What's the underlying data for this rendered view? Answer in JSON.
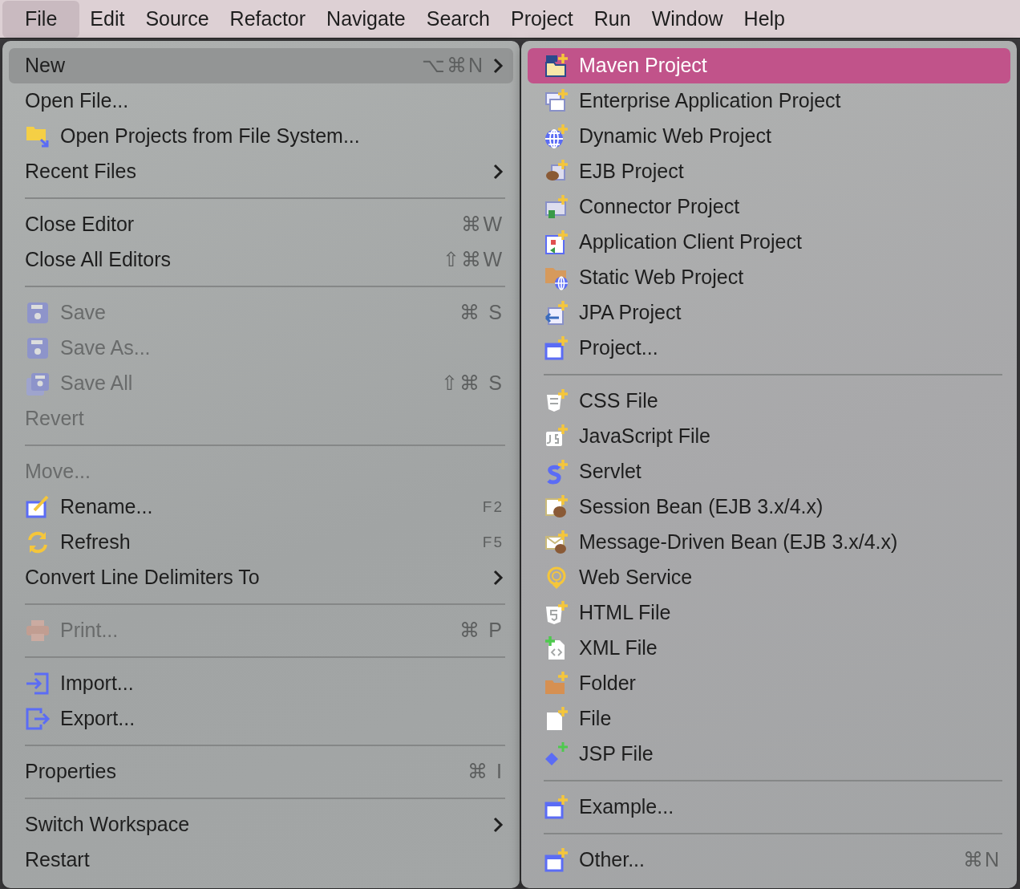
{
  "menu_bar": [
    {
      "label": "File",
      "selected": true
    },
    {
      "label": "Edit",
      "selected": false
    },
    {
      "label": "Source",
      "selected": false
    },
    {
      "label": "Refactor",
      "selected": false
    },
    {
      "label": "Navigate",
      "selected": false
    },
    {
      "label": "Search",
      "selected": false
    },
    {
      "label": "Project",
      "selected": false
    },
    {
      "label": "Run",
      "selected": false
    },
    {
      "label": "Window",
      "selected": false
    },
    {
      "label": "Help",
      "selected": false
    }
  ],
  "file_menu": [
    {
      "kind": "item",
      "label": "New",
      "shortcut": "⌥⌘N",
      "submenu": true,
      "selected": true,
      "disabled": false
    },
    {
      "kind": "item",
      "label": "Open File...",
      "submenu": false,
      "selected": false,
      "disabled": false
    },
    {
      "kind": "item",
      "label": "Open Projects from File System...",
      "submenu": false,
      "selected": false,
      "disabled": false
    },
    {
      "kind": "item",
      "label": "Recent Files",
      "submenu": true,
      "selected": false,
      "disabled": false
    },
    {
      "kind": "separator"
    },
    {
      "kind": "item",
      "label": "Close Editor",
      "shortcut": "⌘W",
      "submenu": false,
      "selected": false,
      "disabled": false
    },
    {
      "kind": "item",
      "label": "Close All Editors",
      "shortcut": "⇧⌘W",
      "submenu": false,
      "selected": false,
      "disabled": false
    },
    {
      "kind": "separator"
    },
    {
      "kind": "item",
      "label": "Save",
      "shortcut": "⌘ S",
      "submenu": false,
      "selected": false,
      "disabled": true
    },
    {
      "kind": "item",
      "label": "Save As...",
      "submenu": false,
      "selected": false,
      "disabled": true
    },
    {
      "kind": "item",
      "label": "Save All",
      "shortcut": "⇧⌘ S",
      "submenu": false,
      "selected": false,
      "disabled": true
    },
    {
      "kind": "item",
      "label": "Revert",
      "submenu": false,
      "selected": false,
      "disabled": true
    },
    {
      "kind": "separator"
    },
    {
      "kind": "item",
      "label": "Move...",
      "submenu": false,
      "selected": false,
      "disabled": true
    },
    {
      "kind": "item",
      "label": "Rename...",
      "shortcut": "F2",
      "submenu": false,
      "selected": false,
      "disabled": false
    },
    {
      "kind": "item",
      "label": "Refresh",
      "shortcut": "F5",
      "submenu": false,
      "selected": false,
      "disabled": false
    },
    {
      "kind": "item",
      "label": "Convert Line Delimiters To",
      "submenu": true,
      "selected": false,
      "disabled": false
    },
    {
      "kind": "separator"
    },
    {
      "kind": "item",
      "label": "Print...",
      "shortcut": "⌘ P",
      "submenu": false,
      "selected": false,
      "disabled": true
    },
    {
      "kind": "separator"
    },
    {
      "kind": "item",
      "label": "Import...",
      "submenu": false,
      "selected": false,
      "disabled": false
    },
    {
      "kind": "item",
      "label": "Export...",
      "submenu": false,
      "selected": false,
      "disabled": false
    },
    {
      "kind": "separator"
    },
    {
      "kind": "item",
      "label": "Properties",
      "shortcut": "⌘ I",
      "submenu": false,
      "selected": false,
      "disabled": false
    },
    {
      "kind": "separator"
    },
    {
      "kind": "item",
      "label": "Switch Workspace",
      "submenu": true,
      "selected": false,
      "disabled": false
    },
    {
      "kind": "item",
      "label": "Restart",
      "submenu": false,
      "selected": false,
      "disabled": false
    }
  ],
  "new_submenu": [
    {
      "kind": "item",
      "label": "Maven Project",
      "selected": true
    },
    {
      "kind": "item",
      "label": "Enterprise Application Project",
      "selected": false
    },
    {
      "kind": "item",
      "label": "Dynamic Web Project",
      "selected": false
    },
    {
      "kind": "item",
      "label": "EJB Project",
      "selected": false
    },
    {
      "kind": "item",
      "label": "Connector Project",
      "selected": false
    },
    {
      "kind": "item",
      "label": "Application Client Project",
      "selected": false
    },
    {
      "kind": "item",
      "label": "Static Web Project",
      "selected": false
    },
    {
      "kind": "item",
      "label": "JPA Project",
      "selected": false
    },
    {
      "kind": "item",
      "label": "Project...",
      "selected": false
    },
    {
      "kind": "separator"
    },
    {
      "kind": "item",
      "label": "CSS File",
      "selected": false
    },
    {
      "kind": "item",
      "label": "JavaScript File",
      "selected": false
    },
    {
      "kind": "item",
      "label": "Servlet",
      "selected": false
    },
    {
      "kind": "item",
      "label": "Session Bean (EJB 3.x/4.x)",
      "selected": false
    },
    {
      "kind": "item",
      "label": "Message-Driven Bean (EJB 3.x/4.x)",
      "selected": false
    },
    {
      "kind": "item",
      "label": "Web Service",
      "selected": false
    },
    {
      "kind": "item",
      "label": "HTML File",
      "selected": false
    },
    {
      "kind": "item",
      "label": "XML File",
      "selected": false
    },
    {
      "kind": "item",
      "label": "Folder",
      "selected": false
    },
    {
      "kind": "item",
      "label": "File",
      "selected": false
    },
    {
      "kind": "item",
      "label": "JSP File",
      "selected": false
    },
    {
      "kind": "separator"
    },
    {
      "kind": "item",
      "label": "Example...",
      "selected": false
    },
    {
      "kind": "separator"
    },
    {
      "kind": "item",
      "label": "Other...",
      "shortcut": "⌘N",
      "selected": false
    }
  ]
}
